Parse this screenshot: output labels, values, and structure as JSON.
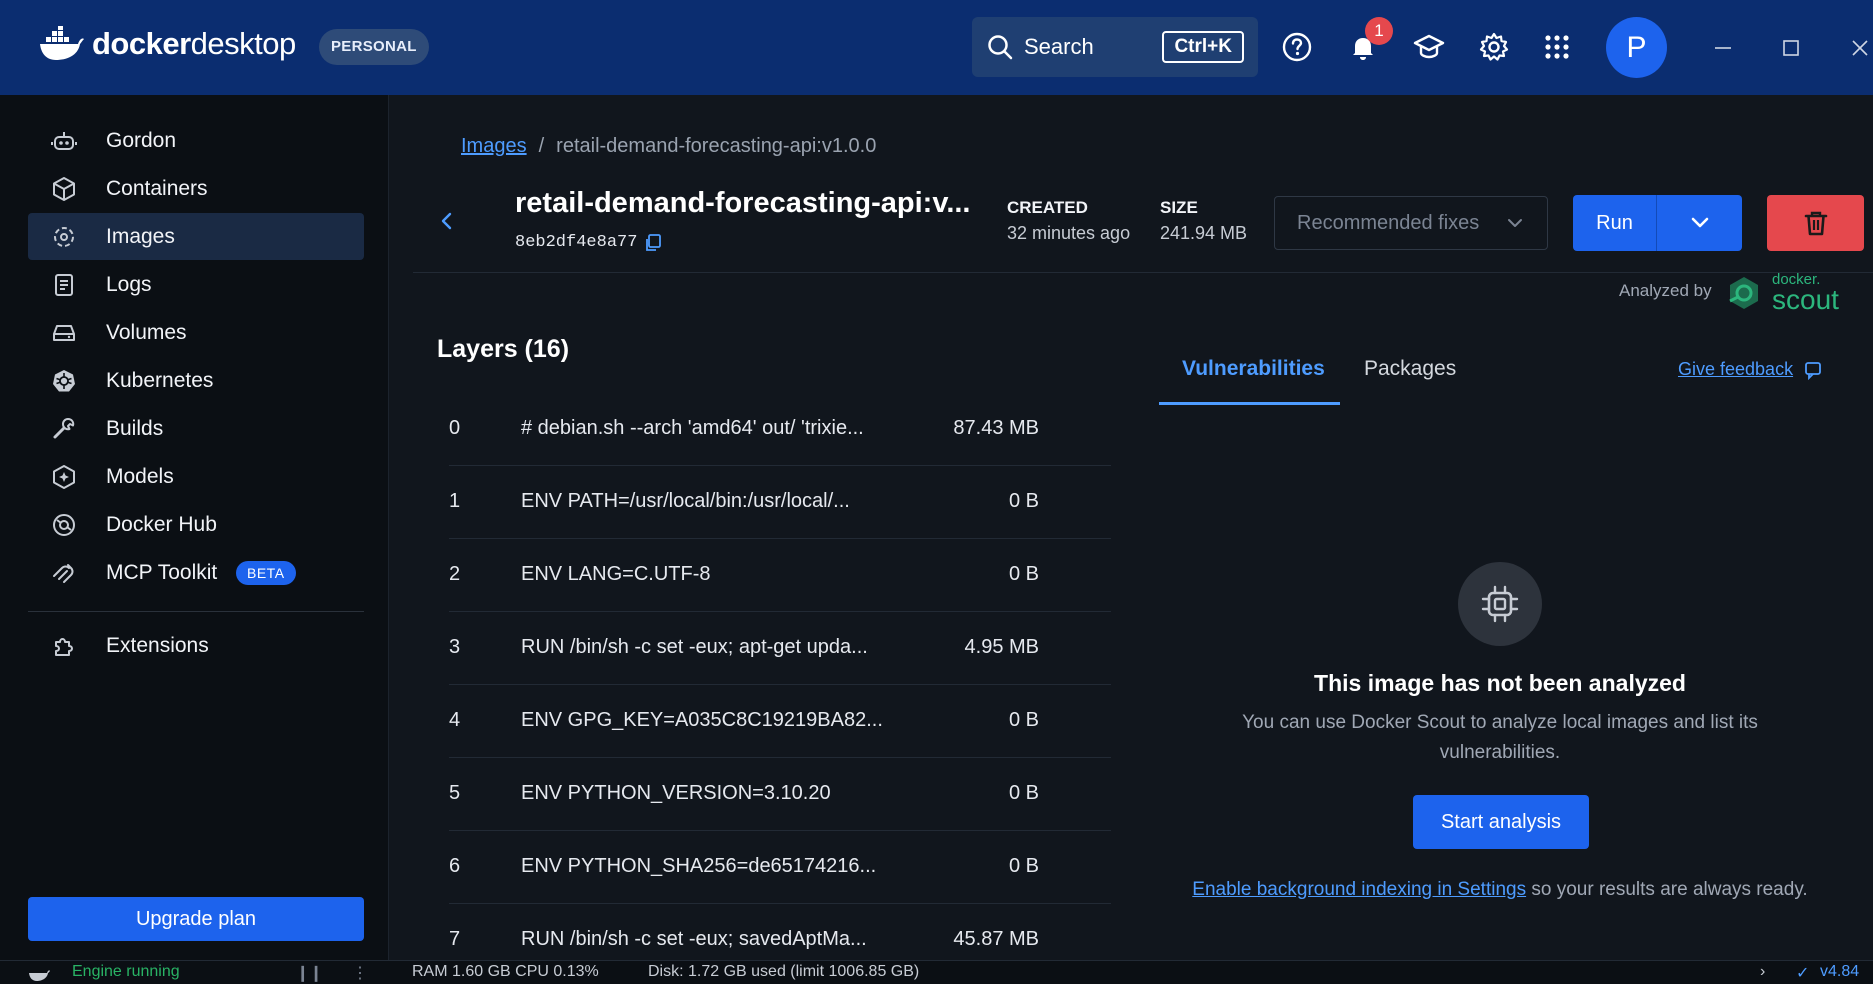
{
  "header": {
    "logo_docker": "docker",
    "logo_desktop": "desktop",
    "edition_badge": "PERSONAL",
    "search_label": "Search",
    "search_shortcut": "Ctrl+K",
    "notification_count": "1",
    "avatar_initial": "P",
    "icons": [
      "help-icon",
      "bell-icon",
      "learning-center-icon",
      "gear-icon",
      "apps-grid-icon"
    ]
  },
  "sidebar": {
    "items": [
      {
        "label": "Gordon",
        "icon": "gordon-robot-icon"
      },
      {
        "label": "Containers",
        "icon": "containers-cube-icon"
      },
      {
        "label": "Images",
        "icon": "images-icon"
      },
      {
        "label": "Logs",
        "icon": "logs-icon"
      },
      {
        "label": "Volumes",
        "icon": "volumes-icon"
      },
      {
        "label": "Kubernetes",
        "icon": "kubernetes-icon"
      },
      {
        "label": "Builds",
        "icon": "wrench-icon"
      },
      {
        "label": "Models",
        "icon": "models-icon"
      },
      {
        "label": "Docker Hub",
        "icon": "docker-hub-icon"
      },
      {
        "label": "MCP Toolkit",
        "icon": "mcp-toolkit-icon"
      }
    ],
    "mcp_badge": "BETA",
    "extensions_label": "Extensions",
    "upgrade_label": "Upgrade plan"
  },
  "statusbar": {
    "engine_status": "Engine running",
    "resources": "RAM 1.60 GB  CPU 0.13%",
    "disk": "Disk: 1.72 GB used (limit 1006.85 GB)",
    "version": "v4.84"
  },
  "main": {
    "breadcrumb_root": "Images",
    "breadcrumb_separator": "/",
    "breadcrumb_current": "retail-demand-forecasting-api:v1.0.0",
    "image_title": "retail-demand-forecasting-api:v...",
    "image_id": "8eb2df4e8a77",
    "created_label": "CREATED",
    "created_value": "32 minutes ago",
    "size_label": "SIZE",
    "size_value": "241.94 MB",
    "recommended_fixes_label": "Recommended fixes",
    "run_label": "Run",
    "analyzed_by_label": "Analyzed by",
    "scout_brand_small": "docker.",
    "scout_brand_word": "scout",
    "layers_title": "Layers (16)",
    "layers": [
      {
        "index": "0",
        "command": "# debian.sh --arch 'amd64' out/ 'trixie...",
        "size": "87.43 MB"
      },
      {
        "index": "1",
        "command": "ENV PATH=/usr/local/bin:/usr/local/...",
        "size": "0 B"
      },
      {
        "index": "2",
        "command": "ENV LANG=C.UTF-8",
        "size": "0 B"
      },
      {
        "index": "3",
        "command": "RUN /bin/sh -c set -eux; apt-get upda...",
        "size": "4.95 MB"
      },
      {
        "index": "4",
        "command": "ENV GPG_KEY=A035C8C19219BA82...",
        "size": "0 B"
      },
      {
        "index": "5",
        "command": "ENV PYTHON_VERSION=3.10.20",
        "size": "0 B"
      },
      {
        "index": "6",
        "command": "ENV PYTHON_SHA256=de65174216...",
        "size": "0 B"
      },
      {
        "index": "7",
        "command": "RUN /bin/sh -c set -eux; savedAptMa...",
        "size": "45.87 MB"
      }
    ],
    "tabs": [
      {
        "label": "Vulnerabilities",
        "active": true
      },
      {
        "label": "Packages",
        "active": false
      }
    ],
    "feedback_label": "Give feedback",
    "not_analyzed_title": "This image has not been analyzed",
    "not_analyzed_desc": "You can use Docker Scout to analyze local images and list its vulnerabilities.",
    "start_analysis_label": "Start analysis",
    "indexing_link": "Enable background indexing in Settings",
    "indexing_rest": " so your results are always ready."
  },
  "colors": {
    "header_bg": "#0b2d70",
    "accent_blue": "#1d63ed",
    "link_blue": "#4e9cff",
    "danger_red": "#e5484d",
    "scout_green": "#2cb67d",
    "engine_green": "#29b365"
  }
}
